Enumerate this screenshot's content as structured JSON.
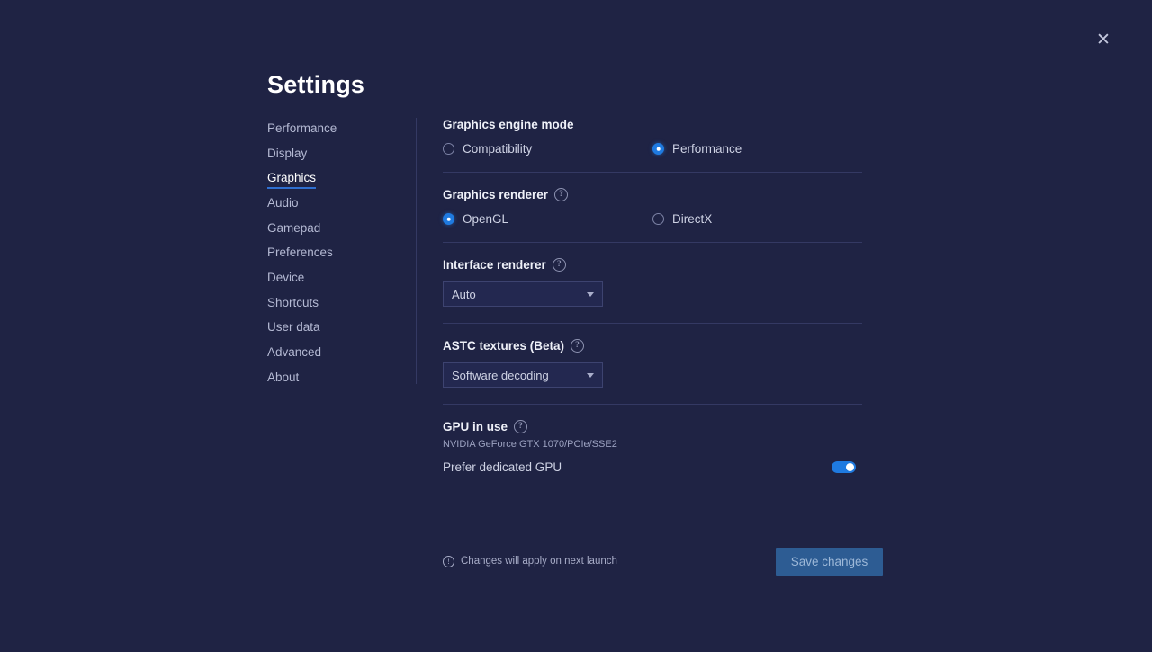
{
  "window": {
    "title": "Settings",
    "close_icon": "close-icon"
  },
  "sidebar": {
    "items": [
      {
        "label": "Performance",
        "active": false
      },
      {
        "label": "Display",
        "active": false
      },
      {
        "label": "Graphics",
        "active": true
      },
      {
        "label": "Audio",
        "active": false
      },
      {
        "label": "Gamepad",
        "active": false
      },
      {
        "label": "Preferences",
        "active": false
      },
      {
        "label": "Device",
        "active": false
      },
      {
        "label": "Shortcuts",
        "active": false
      },
      {
        "label": "User data",
        "active": false
      },
      {
        "label": "Advanced",
        "active": false
      },
      {
        "label": "About",
        "active": false
      }
    ]
  },
  "sections": {
    "engine_mode": {
      "heading": "Graphics engine mode",
      "options": [
        {
          "label": "Compatibility",
          "selected": false
        },
        {
          "label": "Performance",
          "selected": true
        }
      ]
    },
    "graphics_renderer": {
      "heading": "Graphics renderer",
      "help_icon": "help-icon",
      "options": [
        {
          "label": "OpenGL",
          "selected": true
        },
        {
          "label": "DirectX",
          "selected": false
        }
      ]
    },
    "interface_renderer": {
      "heading": "Interface renderer",
      "help_icon": "help-icon",
      "value": "Auto",
      "caret_icon": "chevron-down-icon"
    },
    "astc_textures": {
      "heading": "ASTC textures (Beta)",
      "help_icon": "help-icon",
      "value": "Software decoding",
      "caret_icon": "chevron-down-icon"
    },
    "gpu": {
      "heading": "GPU in use",
      "help_icon": "help-icon",
      "device": "NVIDIA GeForce GTX 1070/PCIe/SSE2",
      "toggle_label": "Prefer dedicated GPU",
      "toggle_on": true
    }
  },
  "footer": {
    "info_icon": "info-icon",
    "note": "Changes will apply on next launch",
    "save_label": "Save changes"
  },
  "colors": {
    "background": "#1f2344",
    "accent": "#1f7ae0",
    "underline": "#2f6fd0",
    "divider": "#343963",
    "save_button_bg": "#2d5c93",
    "save_button_text": "#9db8d8"
  }
}
